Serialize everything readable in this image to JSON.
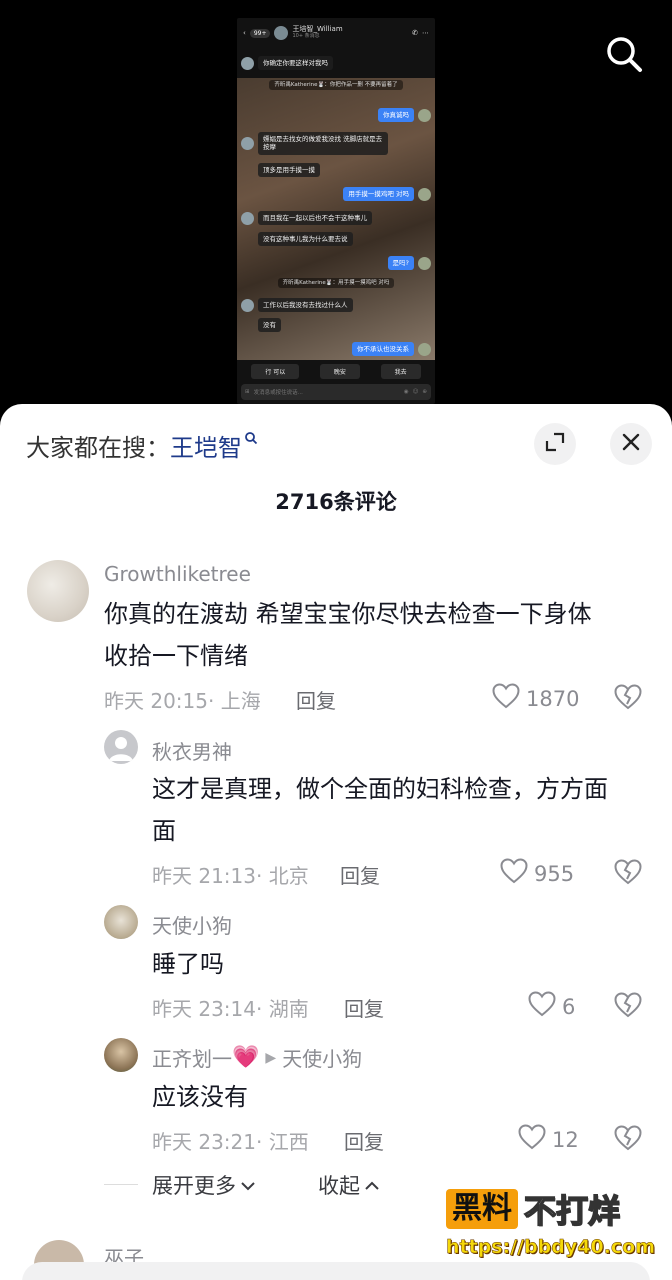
{
  "video": {
    "chat": {
      "badge": "99+",
      "contact_name": "王培智_William",
      "contact_sub": "10+ 条消息",
      "messages": [
        {
          "side": "left",
          "text": "你确定你要这样对我吗"
        },
        {
          "side": "system",
          "text": "齐昕禹Katherine🐰：你把作品一删 不要再留着了"
        },
        {
          "side": "right",
          "text": "你真诚吗"
        },
        {
          "side": "left",
          "text": "嫖娼是去找女的做爱我没找 洗脚店就是去按摩"
        },
        {
          "side": "left",
          "text": "顶多是用手摸一摸"
        },
        {
          "side": "right",
          "text": "用手摸一摸鸡吧 对吗"
        },
        {
          "side": "left",
          "text": "而且我在一起以后也不会干这种事儿"
        },
        {
          "side": "left",
          "text": "没有这种事儿我为什么要去说"
        },
        {
          "side": "right",
          "text": "是吗?"
        },
        {
          "side": "system",
          "text": "齐昕禹Katherine🐰：用手摸一摸鸡吧 对吗"
        },
        {
          "side": "left",
          "text": "工作以后我没有去找过什么人"
        },
        {
          "side": "left",
          "text": "没有"
        },
        {
          "side": "right",
          "text": "你不承认也没关系"
        }
      ],
      "quick_replies": [
        "行 可以",
        "晚安",
        "我去"
      ],
      "input_placeholder": "发消息或按住说话..."
    }
  },
  "sheet": {
    "hot_search_prefix": "大家都在搜：",
    "hot_search_keyword": "王垲智",
    "comment_count": "2716条评论",
    "comments": [
      {
        "user": "Growthliketree",
        "text_line1": "你真的在渡劫 希望宝宝你尽快去检查一下身体",
        "text_line2": "收拾一下情绪",
        "time": "昨天 20:15",
        "location": "· 上海",
        "reply": "回复",
        "likes": "1870"
      },
      {
        "user": "秋衣男神",
        "text_line1": "这才是真理，做个全面的妇科检查，方方面",
        "text_line2": "面",
        "time": "昨天 21:13",
        "location": "· 北京",
        "reply": "回复",
        "likes": "955"
      },
      {
        "user": "天使小狗",
        "text": "睡了吗",
        "time": "昨天 23:14",
        "location": "· 湖南",
        "reply": "回复",
        "likes": "6"
      },
      {
        "user": "正齐划一",
        "user_emoji": "💗",
        "reply_to": "天使小狗",
        "text": "应该没有",
        "time": "昨天 23:21",
        "location": "· 江西",
        "reply": "回复",
        "likes": "12"
      }
    ],
    "expand_more": "展开更多",
    "collapse": "收起",
    "next_user_partial": "巫子"
  },
  "watermark": {
    "box_text": "黑料",
    "text": "不打烊",
    "url": "https://bbdy40.com"
  }
}
